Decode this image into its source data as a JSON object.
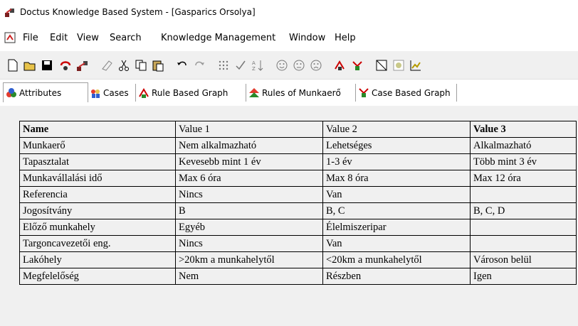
{
  "window": {
    "title": "Doctus Knowledge Based System - [Gasparics Orsolya]"
  },
  "menu": [
    "File",
    "Edit",
    "View",
    "Search",
    "Knowledge Management",
    "Window",
    "Help"
  ],
  "toolbar": [
    "new-icon",
    "open-icon",
    "save-icon",
    "red-arrow-icon",
    "tree-icon",
    "eraser-icon",
    "cut-icon",
    "copy-icon",
    "paste-icon",
    "undo-icon",
    "redo-icon",
    "grid-icon",
    "check-icon",
    "sort-icon",
    "smiley-1-icon",
    "smiley-2-icon",
    "smiley-3-icon",
    "rule-graph-icon",
    "case-graph-icon",
    "rect-icon",
    "paint-icon",
    "chart-icon"
  ],
  "tabs": [
    {
      "label": "Attributes",
      "icon": "attributes-icon"
    },
    {
      "label": "Cases",
      "icon": "cases-icon"
    },
    {
      "label": "Rule Based Graph",
      "icon": "rule-graph-icon"
    },
    {
      "label": "Rules of Munkaerő",
      "icon": "rules-icon"
    },
    {
      "label": "Case Based Graph",
      "icon": "case-graph-icon"
    }
  ],
  "table": {
    "headers": [
      "Name",
      "Value 1",
      "Value 2",
      "Value 3"
    ],
    "rows": [
      [
        "Munkaerő",
        "Nem alkalmazható",
        "Lehetséges",
        "Alkalmazható"
      ],
      [
        "Tapasztalat",
        "Kevesebb mint 1 év",
        "1-3 év",
        "Több mint 3 év"
      ],
      [
        "Munkavállalási idő",
        "Max 6 óra",
        "Max 8 óra",
        "Max 12 óra"
      ],
      [
        "Referencia",
        "Nincs",
        "Van",
        ""
      ],
      [
        "Jogosítvány",
        "B",
        "B, C",
        "B, C, D"
      ],
      [
        "Előző munkahely",
        "Egyéb",
        "Élelmiszeripar",
        ""
      ],
      [
        "Targoncavezetői eng.",
        "Nincs",
        "Van",
        ""
      ],
      [
        "Lakóhely",
        ">20km a munkahelytől",
        "<20km a munkahelytől",
        "Városon belül"
      ],
      [
        "Megfelelőség",
        "Nem",
        "Részben",
        "Igen"
      ]
    ]
  }
}
